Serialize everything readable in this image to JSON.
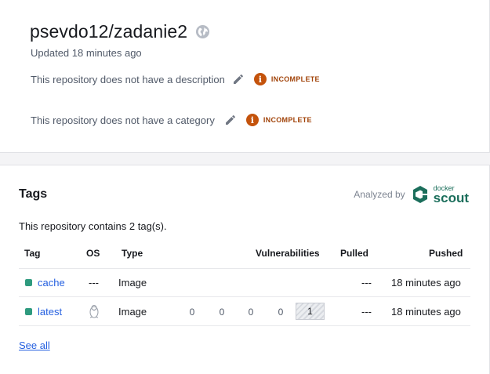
{
  "repo": {
    "title": "psevdo12/zadanie2",
    "updated": "Updated 18 minutes ago",
    "description_text": "This repository does not have a description",
    "category_text": "This repository does not have a category",
    "incomplete_label": "INCOMPLETE",
    "info_glyph": "i"
  },
  "tags": {
    "heading": "Tags",
    "analyzed_by": "Analyzed by",
    "scout_brand_top": "docker",
    "scout_brand_name": "scout",
    "contains": "This repository contains 2 tag(s).",
    "columns": {
      "tag": "Tag",
      "os": "OS",
      "type": "Type",
      "vulnerabilities": "Vulnerabilities",
      "pulled": "Pulled",
      "pushed": "Pushed"
    },
    "rows": [
      {
        "tag": "cache",
        "os": "---",
        "type": "Image",
        "pulled": "---",
        "pushed": "18 minutes ago"
      },
      {
        "tag": "latest",
        "os_icon": "linux-penguin-icon",
        "type": "Image",
        "vuln_critical": "0",
        "vuln_high": "0",
        "vuln_medium": "0",
        "vuln_low": "0",
        "vuln_unspecified": "1",
        "pulled": "---",
        "pushed": "18 minutes ago"
      }
    ],
    "see_all": "See all"
  },
  "colors": {
    "accent_link": "#2560e0",
    "incomplete": "#c4530c",
    "tag_status": "#2e9a7e",
    "scout_brand": "#1b6e5b"
  }
}
